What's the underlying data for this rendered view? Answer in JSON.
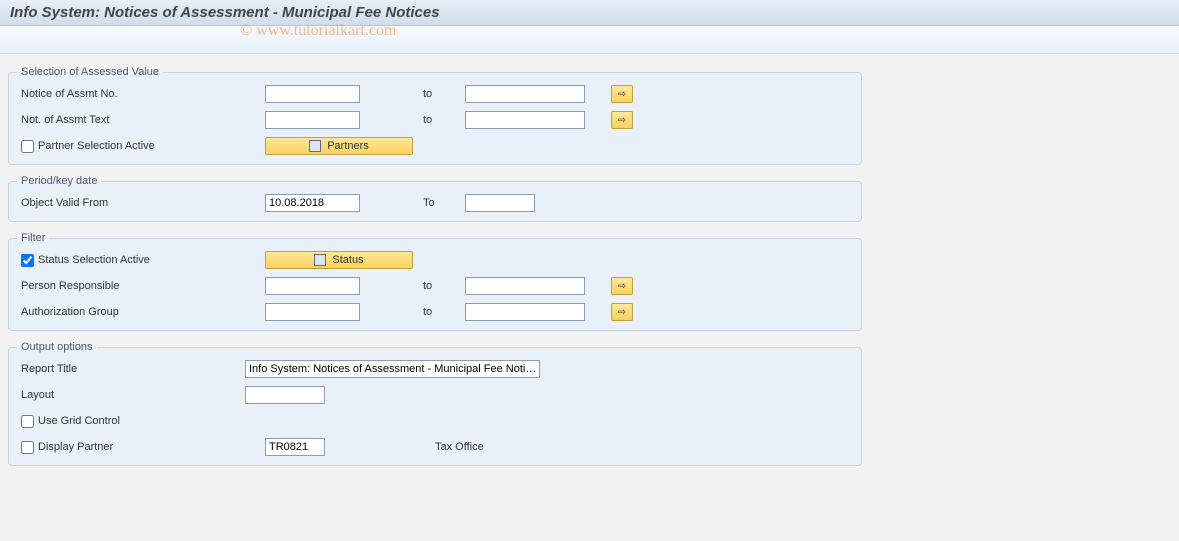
{
  "header": {
    "title": "Info System: Notices of Assessment - Municipal Fee Notices"
  },
  "watermark": "© www.tutorialkart.com",
  "groups": {
    "assessed": {
      "legend": "Selection of Assessed Value",
      "notice_no_label": "Notice of Assmt No.",
      "notice_text_label": "Not. of Assmt Text",
      "to": "to",
      "partner_check_label": "Partner Selection Active",
      "partners_btn": "Partners",
      "notice_no_from": "",
      "notice_no_to": "",
      "notice_text_from": "",
      "notice_text_to": "",
      "partner_active": false
    },
    "period": {
      "legend": "Period/key date",
      "valid_from_label": "Object Valid From",
      "to": "To",
      "valid_from": "10.08.2018",
      "valid_to": ""
    },
    "filter": {
      "legend": "Filter",
      "status_check_label": "Status Selection Active",
      "status_btn": "Status",
      "status_active": true,
      "person_label": "Person Responsible",
      "authgrp_label": "Authorization Group",
      "to": "to",
      "person_from": "",
      "person_to": "",
      "authgrp_from": "",
      "authgrp_to": ""
    },
    "output": {
      "legend": "Output options",
      "report_title_label": "Report Title",
      "report_title": "Info System: Notices of Assessment - Municipal Fee Noti…",
      "layout_label": "Layout",
      "layout": "",
      "grid_label": "Use Grid Control",
      "grid": false,
      "display_partner_label": "Display Partner",
      "display_partner": false,
      "partner_code": "TR0821",
      "partner_desc": "Tax Office"
    }
  },
  "icons": {
    "arrow": "⇨"
  }
}
